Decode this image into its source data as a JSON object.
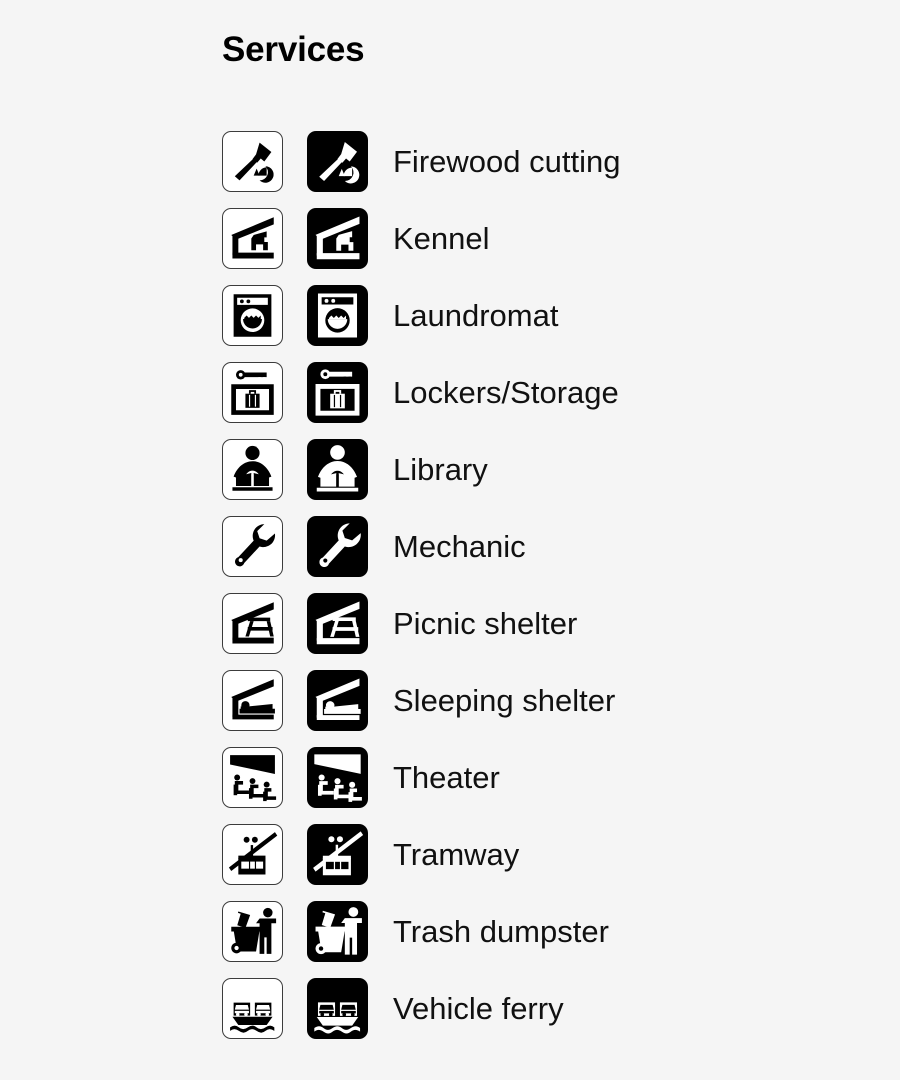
{
  "header": {
    "title": "Services"
  },
  "legend": {
    "items": [
      {
        "label": "Firewood cutting",
        "icon": "firewood-cutting-icon"
      },
      {
        "label": "Kennel",
        "icon": "kennel-icon"
      },
      {
        "label": "Laundromat",
        "icon": "laundromat-icon"
      },
      {
        "label": "Lockers/Storage",
        "icon": "lockers-storage-icon"
      },
      {
        "label": "Library",
        "icon": "library-icon"
      },
      {
        "label": "Mechanic",
        "icon": "mechanic-icon"
      },
      {
        "label": "Picnic shelter",
        "icon": "picnic-shelter-icon"
      },
      {
        "label": "Sleeping shelter",
        "icon": "sleeping-shelter-icon"
      },
      {
        "label": "Theater",
        "icon": "theater-icon"
      },
      {
        "label": "Tramway",
        "icon": "tramway-icon"
      },
      {
        "label": "Trash dumpster",
        "icon": "trash-dumpster-icon"
      },
      {
        "label": "Vehicle ferry",
        "icon": "vehicle-ferry-icon"
      }
    ]
  },
  "style": {
    "background_color": "#f5f5f5",
    "symbol_color": "#000000",
    "light_tile_color": "#ffffff",
    "text_color": "#111111"
  }
}
